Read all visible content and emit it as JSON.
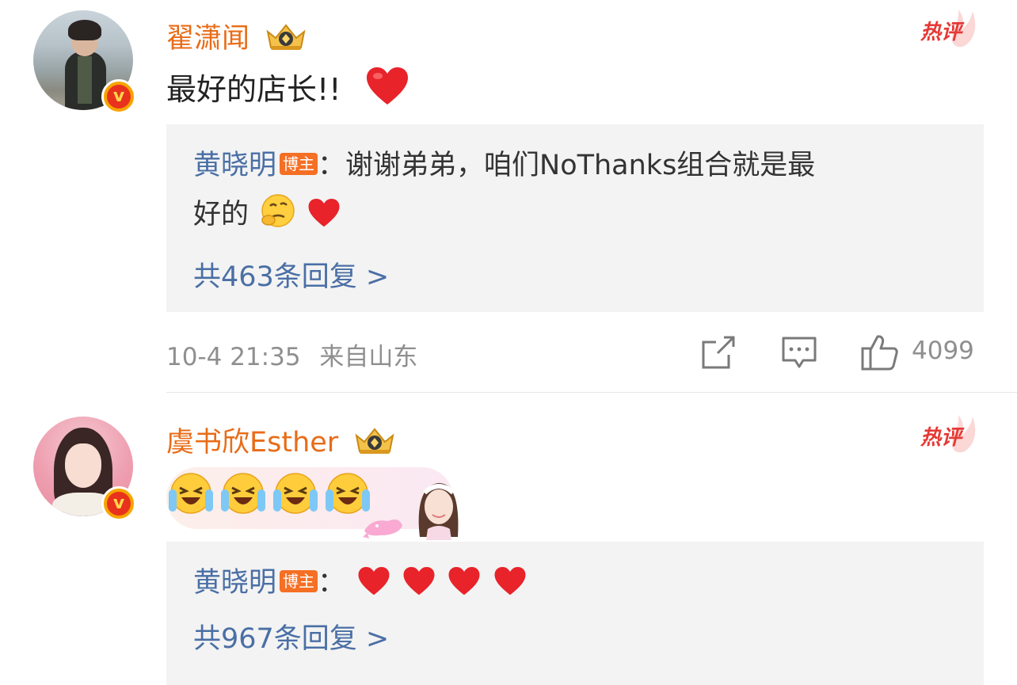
{
  "comments": [
    {
      "username": "翟潇闻",
      "hot_label": "热评",
      "text": "最好的店长!!",
      "reply": {
        "author": "黄晓明",
        "badge": "博主",
        "text_line1": "：谢谢弟弟，咱们NoThanks组合就是最",
        "text_line2": "好的"
      },
      "reply_count_text": "共463条回复 >",
      "timestamp": "10-4 21:35",
      "location": "来自山东",
      "like_count": "4099"
    },
    {
      "username": "虞书欣Esther",
      "hot_label": "热评",
      "reply": {
        "author": "黄晓明",
        "badge": "博主",
        "text": "："
      },
      "reply_count_text": "共967条回复 >"
    }
  ],
  "icons": {
    "verified": "verified-v-badge-icon",
    "crown": "vip-crown-icon",
    "heart": "red-heart-emoji",
    "share": "share-edit-icon",
    "comment": "comment-bubble-icon",
    "like": "thumbs-up-icon"
  },
  "colors": {
    "username": "#e86c18",
    "link": "#4a6fa5",
    "hot": "#e53935",
    "reply_bg": "#f3f3f3",
    "meta": "#8f8f8f"
  }
}
